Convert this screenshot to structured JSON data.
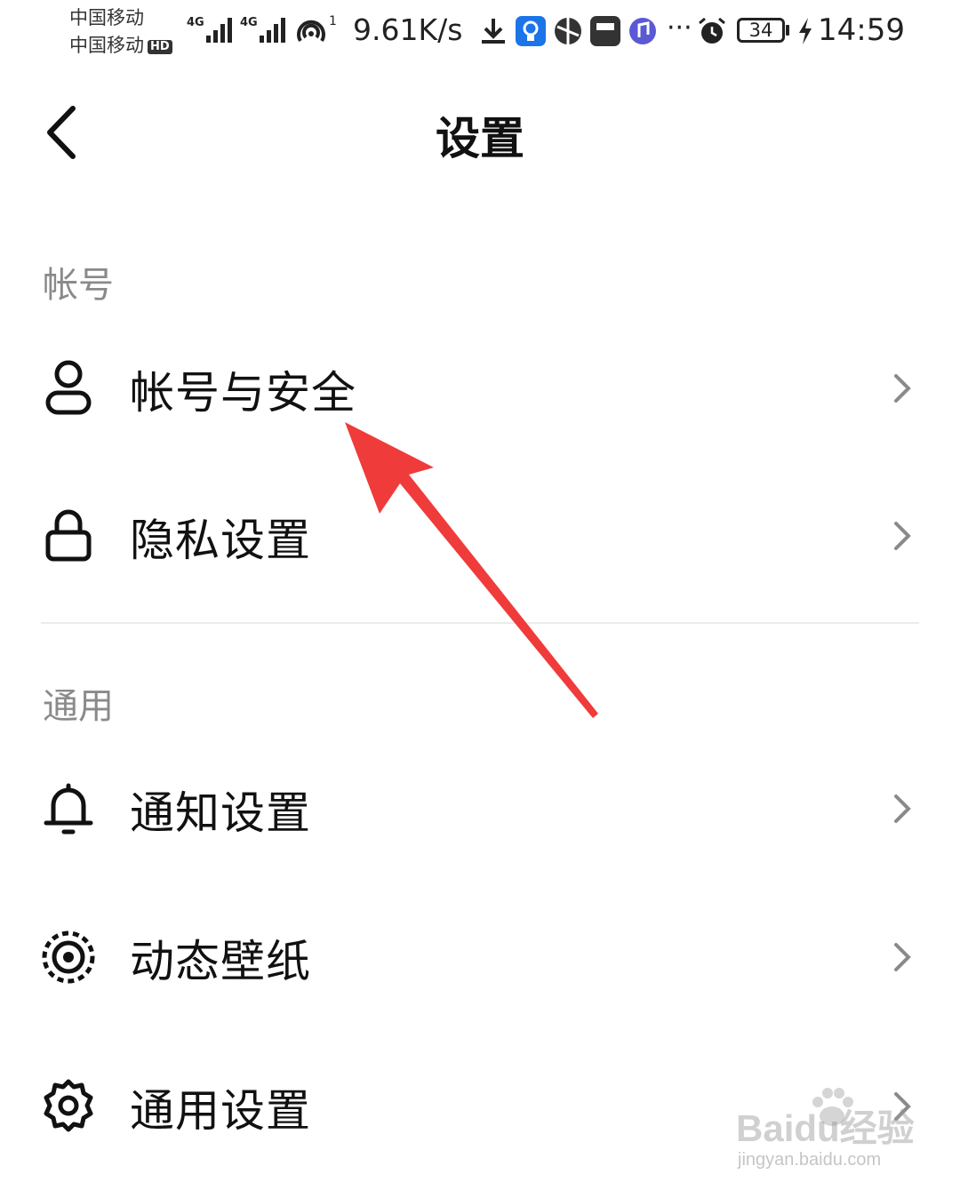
{
  "status_bar": {
    "carrier_1": "中国移动",
    "carrier_2": "中国移动",
    "hd_badge": "HD",
    "signal_1_label": "4G",
    "signal_2_label": "4G",
    "hotspot_count": "1",
    "net_speed": "9.61K/s",
    "battery_level": "34",
    "time": "14:59",
    "overflow": "···",
    "app_icons": [
      "download-icon",
      "lightbulb-app-icon",
      "browser-app-icon",
      "huawei-app-icon",
      "music-app-icon"
    ]
  },
  "header": {
    "title": "设置",
    "back_icon": "back-chevron-icon"
  },
  "sections": [
    {
      "title": "帐号",
      "items": [
        {
          "label": "帐号与安全",
          "icon": "user-icon"
        },
        {
          "label": "隐私设置",
          "icon": "lock-icon"
        }
      ]
    },
    {
      "title": "通用",
      "items": [
        {
          "label": "通知设置",
          "icon": "bell-icon"
        },
        {
          "label": "动态壁纸",
          "icon": "live-wallpaper-icon"
        },
        {
          "label": "通用设置",
          "icon": "gear-icon"
        }
      ]
    }
  ],
  "annotation": {
    "color": "#f03b3b",
    "points_to": "帐号与安全"
  },
  "watermark": {
    "brand": "Baidu经验",
    "url": "jingyan.baidu.com"
  }
}
